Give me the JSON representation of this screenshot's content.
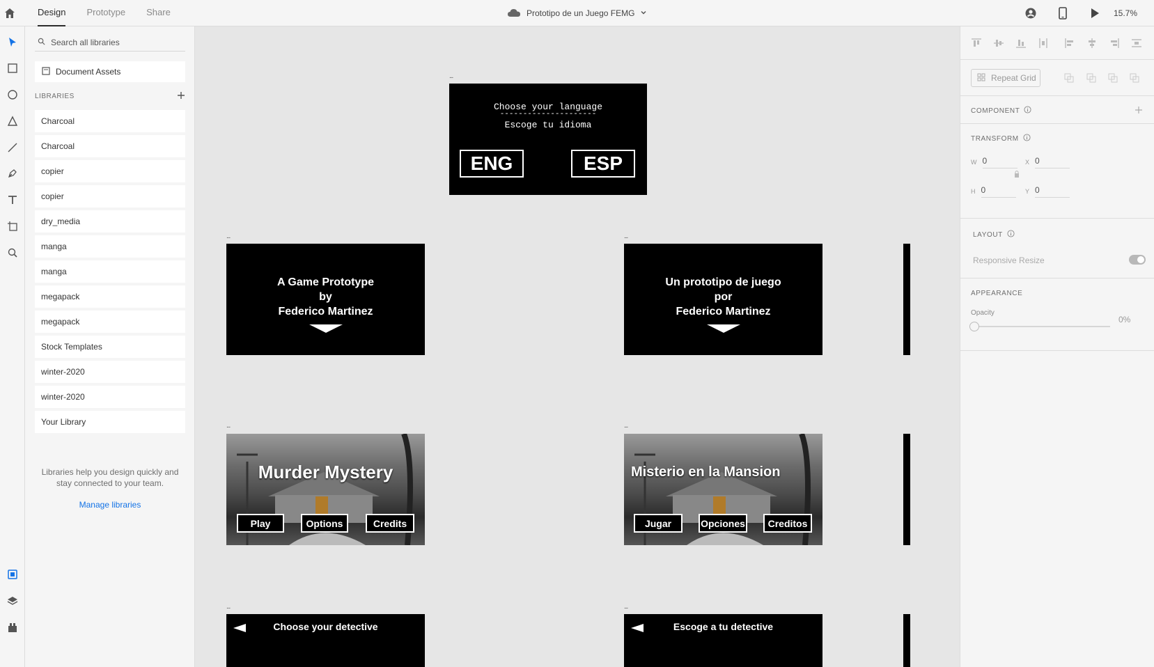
{
  "topbar": {
    "tabs": [
      {
        "label": "Design",
        "active": true
      },
      {
        "label": "Prototype",
        "active": false
      },
      {
        "label": "Share",
        "active": false
      }
    ],
    "document_title": "Prototipo de un Juego FEMG",
    "zoom": "15.7%"
  },
  "tools": [
    "select-icon",
    "rectangle-icon",
    "ellipse-icon",
    "polygon-icon",
    "line-icon",
    "pen-icon",
    "text-icon",
    "artboard-icon",
    "zoom-icon"
  ],
  "libraries": {
    "search_placeholder": "Search all libraries",
    "document_assets": "Document Assets",
    "header": "LIBRARIES",
    "items": [
      "Charcoal",
      "Charcoal",
      "copier",
      "copier",
      "dry_media",
      "manga",
      "manga",
      "megapack",
      "megapack",
      "Stock Templates",
      "winter-2020",
      "winter-2020",
      "Your Library"
    ],
    "help_text": "Libraries help you design quickly and stay connected to your team.",
    "manage_link": "Manage libraries"
  },
  "canvas": {
    "language": {
      "title": "Choose your language",
      "divider": "---------------------",
      "subtitle": "Escoge tu idioma",
      "eng": "ENG",
      "esp": "ESP"
    },
    "credit_en": {
      "line1": "A Game Prototype",
      "line2": "by",
      "line3": "Federico Martinez"
    },
    "credit_es": {
      "line1": "Un prototipo de juego",
      "line2": "por",
      "line3": "Federico Martinez"
    },
    "menu_en": {
      "title": "Murder Mystery",
      "buttons": [
        "Play",
        "Options",
        "Credits"
      ]
    },
    "menu_es": {
      "title": "Misterio en la Mansion",
      "buttons": [
        "Jugar",
        "Opciones",
        "Creditos"
      ]
    },
    "detective_en": "Choose your detective",
    "detective_es": "Escoge a tu detective",
    "artboard_marker": "..."
  },
  "inspector": {
    "repeat_grid": "Repeat Grid",
    "component": "COMPONENT",
    "transform": "TRANSFORM",
    "w_label": "W",
    "w": "0",
    "x_label": "X",
    "x": "0",
    "h_label": "H",
    "h": "0",
    "y_label": "Y",
    "y": "0",
    "layout": "LAYOUT",
    "responsive_resize": "Responsive Resize",
    "appearance": "APPEARANCE",
    "opacity_label": "Opacity",
    "opacity_value": "0%"
  }
}
